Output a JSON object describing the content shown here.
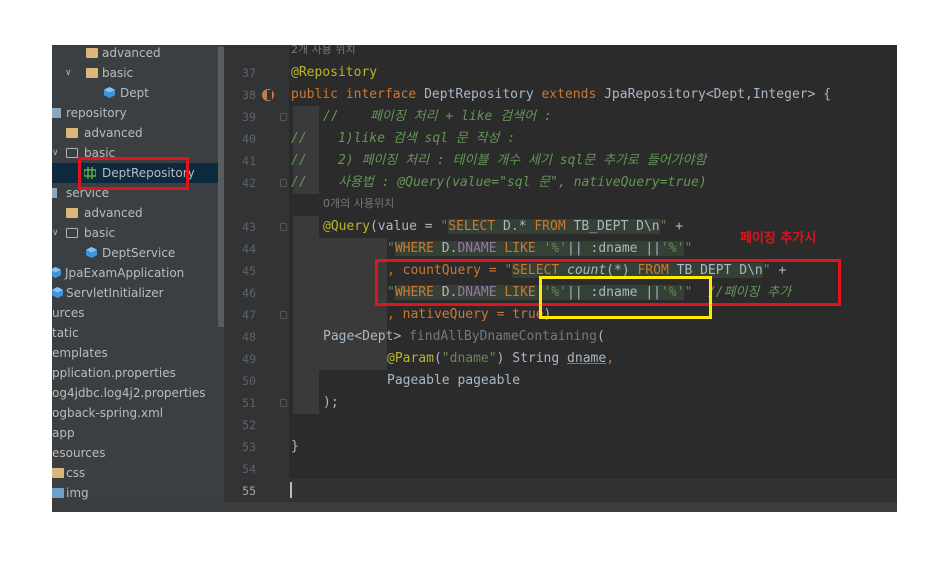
{
  "tree": {
    "items": [
      {
        "label": "advanced",
        "icon": "folder-icon"
      },
      {
        "label": "basic",
        "icon": "folder-icon"
      },
      {
        "label": "Dept",
        "icon": "class-icon"
      },
      {
        "label": "repository",
        "icon": "package-icon"
      },
      {
        "label": "advanced",
        "icon": "folder-icon"
      },
      {
        "label": "basic",
        "icon": "package-outline-icon"
      },
      {
        "label": "DeptRepository",
        "icon": "interface-icon"
      },
      {
        "label": "service",
        "icon": "package-icon"
      },
      {
        "label": "advanced",
        "icon": "folder-icon"
      },
      {
        "label": "basic",
        "icon": "package-outline-icon"
      },
      {
        "label": "DeptService",
        "icon": "class-icon"
      },
      {
        "label": "JpaExamApplication",
        "icon": "class-icon"
      },
      {
        "label": "ServletInitializer",
        "icon": "class-icon"
      },
      {
        "label": "urces",
        "icon": ""
      },
      {
        "label": "tatic",
        "icon": ""
      },
      {
        "label": "emplates",
        "icon": ""
      },
      {
        "label": "pplication.properties",
        "icon": ""
      },
      {
        "label": "og4jdbc.log4j2.properties",
        "icon": ""
      },
      {
        "label": "ogback-spring.xml",
        "icon": ""
      },
      {
        "label": "app",
        "icon": ""
      },
      {
        "label": "esources",
        "icon": ""
      },
      {
        "label": "css",
        "icon": "folder-icon"
      },
      {
        "label": "img",
        "icon": "folder-icon"
      }
    ]
  },
  "editor": {
    "usage_hint_top": "2개 사용 위치",
    "usage_hint_query": "0개의 사용위치",
    "line_numbers": [
      "37",
      "38",
      "39",
      "40",
      "41",
      "42",
      "43",
      "44",
      "45",
      "46",
      "47",
      "48",
      "49",
      "50",
      "51",
      "52",
      "53",
      "54",
      "55"
    ],
    "lines": {
      "l37": "@Repository",
      "l38_public": "public",
      "l38_interface": "interface",
      "l38_name": "DeptRepository",
      "l38_extends": "extends",
      "l38_type": "JpaRepository<Dept,Integer> {",
      "l39": "//    페이징 처리 + like 검색어 :",
      "l40": "//    1)like 검색 sql 문 작성 :",
      "l41": "//    2) 페이징 처리 : 테이블 개수 세기 sql문 추가로 들어가야함",
      "l42": "//    사용법 : @Query(value=\"sql 문\", nativeQuery=true)",
      "l43_ann": "@Query",
      "l43_open": "(value = ",
      "l43_q1": "\"",
      "l43_select": "SELECT",
      "l43_d": " D.* ",
      "l43_from": "FROM",
      "l43_tbl": " TB_DEPT D\\n",
      "l43_q2": "\"",
      "l43_plus": " +",
      "l44_q1": "\"",
      "l44_where": "WHERE",
      "l44_col": " D.",
      "l44_dname": "DNAME",
      "l44_like": " LIKE ",
      "l44_pct": "'%'",
      "l44_rest": "|| :dname ||",
      "l44_pct2": "'%'",
      "l44_q2": "\"",
      "l45_comma": ", countQuery = ",
      "l45_q1": "\"",
      "l45_select": "SELECT",
      "l45_count": " count",
      "l45_star": "(*) ",
      "l45_from": "FROM",
      "l45_tbl": " TB_DEPT D\\n",
      "l45_q2": "\"",
      "l45_plus": " +",
      "l46_q1": "\"",
      "l46_where": "WHERE",
      "l46_col": " D.",
      "l46_dname": "DNAME",
      "l46_like": " LIKE ",
      "l46_pct": "'%'",
      "l46_rest": "|| :dname ||",
      "l46_pct2": "'%'",
      "l46_q2": "\"",
      "l46_comment": "  //페이징 추가",
      "l47_comma": ", nativeQuery = ",
      "l47_true": "true",
      "l47_close": ")",
      "l48_type": "Page<Dept> ",
      "l48_fn": "findAllByDnameContaining",
      "l48_open": "(",
      "l49_ann": "@Param",
      "l49_open": "(",
      "l49_str": "\"dname\"",
      "l49_close": ") String ",
      "l49_var": "dname",
      "l49_comma": ",",
      "l50": "Pageable pageable",
      "l51": ");",
      "l53": "}"
    }
  },
  "annotation": {
    "label": "페이징 추가시"
  },
  "colors": {
    "red_box": "#e0141e",
    "yellow_box": "#ffea00"
  }
}
